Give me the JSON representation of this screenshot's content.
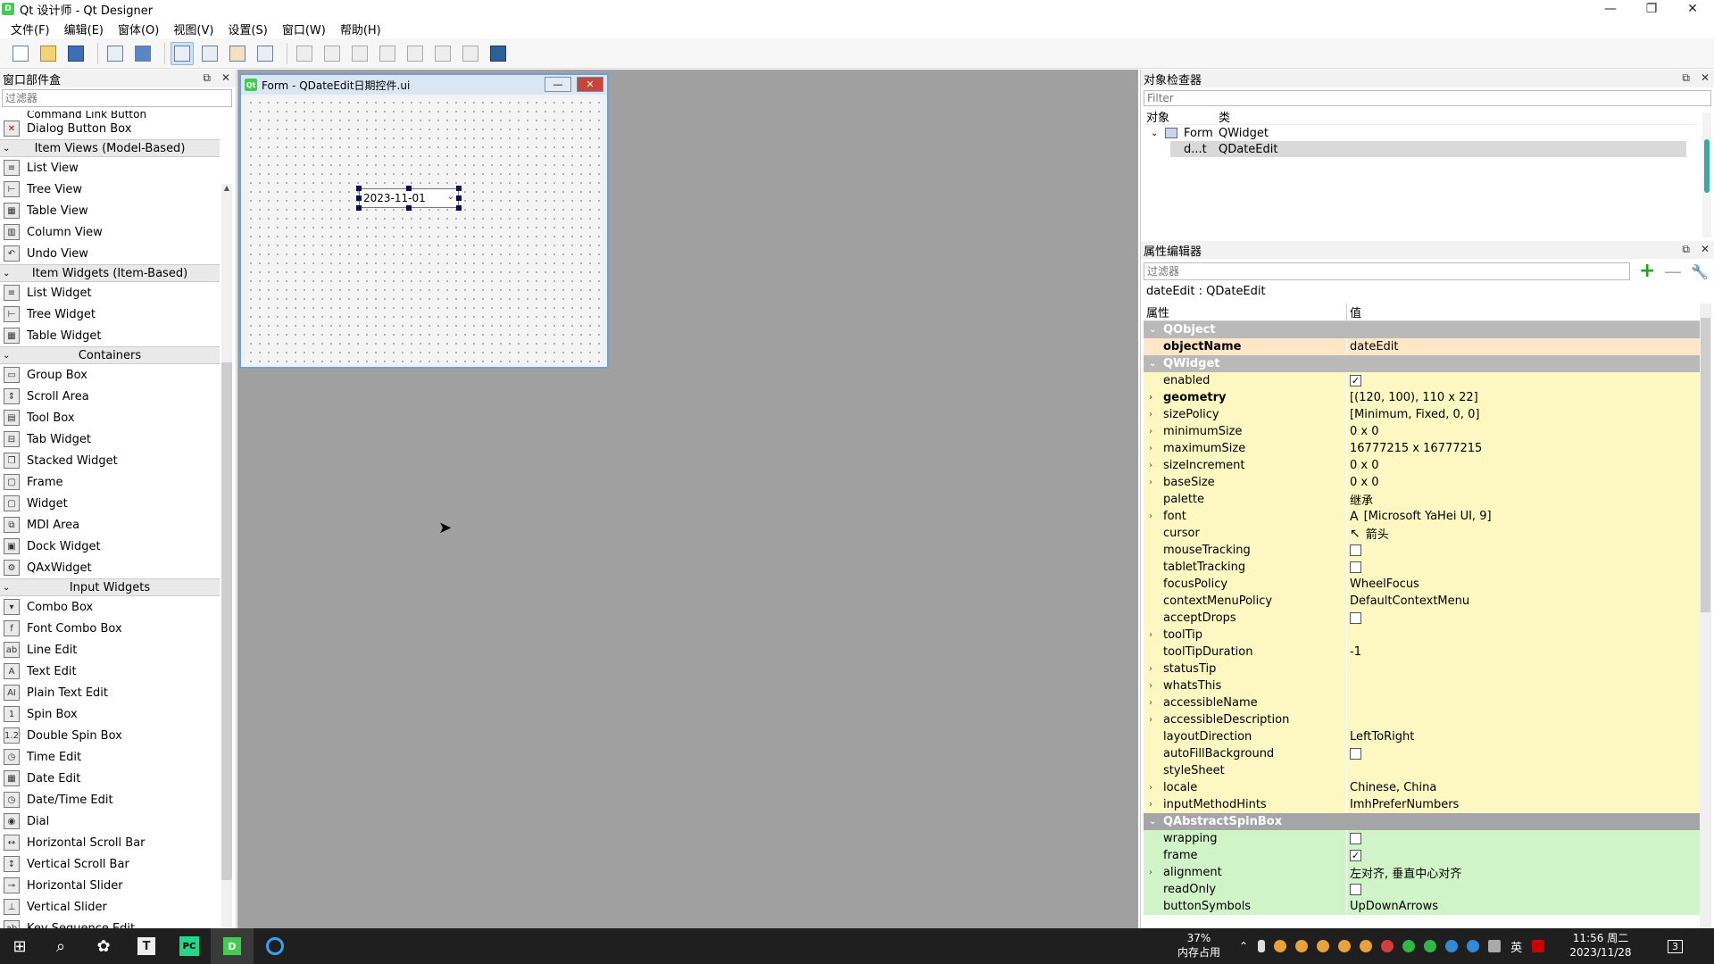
{
  "window": {
    "title": "Qt 设计师 - Qt Designer",
    "controls": {
      "minimize": "—",
      "maximize": "❐",
      "close": "✕"
    }
  },
  "menubar": {
    "items": [
      "文件(F)",
      "编辑(E)",
      "窗体(O)",
      "视图(V)",
      "设置(S)",
      "窗口(W)",
      "帮助(H)"
    ]
  },
  "widget_box": {
    "title": "窗口部件盒",
    "filter_placeholder": "过滤器",
    "partial_item": "Command Link Button",
    "items_top": [
      {
        "label": "Dialog Button Box",
        "icon": "dialog-button-box-icon"
      }
    ],
    "categories": [
      {
        "name": "Item Views (Model-Based)",
        "items": [
          "List View",
          "Tree View",
          "Table View",
          "Column View",
          "Undo View"
        ]
      },
      {
        "name": "Item Widgets (Item-Based)",
        "items": [
          "List Widget",
          "Tree Widget",
          "Table Widget"
        ]
      },
      {
        "name": "Containers",
        "items": [
          "Group Box",
          "Scroll Area",
          "Tool Box",
          "Tab Widget",
          "Stacked Widget",
          "Frame",
          "Widget",
          "MDI Area",
          "Dock Widget",
          "QAxWidget"
        ]
      },
      {
        "name": "Input Widgets",
        "items": [
          "Combo Box",
          "Font Combo Box",
          "Line Edit",
          "Text Edit",
          "Plain Text Edit",
          "Spin Box",
          "Double Spin Box",
          "Time Edit",
          "Date Edit",
          "Date/Time Edit",
          "Dial",
          "Horizontal Scroll Bar",
          "Vertical Scroll Bar",
          "Horizontal Slider",
          "Vertical Slider",
          "Key Sequence Edit"
        ]
      }
    ]
  },
  "form": {
    "title": "Form - QDateEdit日期控件.ui",
    "date_value": "2023-11-01"
  },
  "object_inspector": {
    "title": "对象检查器",
    "filter_placeholder": "Filter",
    "col_object": "对象",
    "col_class": "类",
    "rows": [
      {
        "object": "Form",
        "class": "QWidget"
      },
      {
        "object": "d...t",
        "class": "QDateEdit"
      }
    ]
  },
  "property_editor": {
    "title": "属性编辑器",
    "filter_placeholder": "过滤器",
    "object_class": "dateEdit : QDateEdit",
    "col_property": "属性",
    "col_value": "值",
    "rows": [
      {
        "kind": "group",
        "name": "QObject"
      },
      {
        "kind": "obj",
        "name": "objectName",
        "value": "dateEdit",
        "bold": true
      },
      {
        "kind": "group",
        "name": "QWidget"
      },
      {
        "kind": "wid",
        "name": "enabled",
        "check": true
      },
      {
        "kind": "wid",
        "name": "geometry",
        "value": "[(120, 100), 110 x 22]",
        "bold": true,
        "expand": true
      },
      {
        "kind": "wid",
        "name": "sizePolicy",
        "value": "[Minimum, Fixed, 0, 0]",
        "expand": true
      },
      {
        "kind": "wid",
        "name": "minimumSize",
        "value": "0 x 0",
        "expand": true
      },
      {
        "kind": "wid",
        "name": "maximumSize",
        "value": "16777215 x 16777215",
        "expand": true
      },
      {
        "kind": "wid",
        "name": "sizeIncrement",
        "value": "0 x 0",
        "expand": true
      },
      {
        "kind": "wid",
        "name": "baseSize",
        "value": "0 x 0",
        "expand": true
      },
      {
        "kind": "wid",
        "name": "palette",
        "value": "继承"
      },
      {
        "kind": "wid",
        "name": "font",
        "value": "[Microsoft YaHei UI, 9]",
        "expand": true,
        "prefix": "A"
      },
      {
        "kind": "wid",
        "name": "cursor",
        "value": "箭头",
        "prefix": "↖"
      },
      {
        "kind": "wid",
        "name": "mouseTracking",
        "check": false
      },
      {
        "kind": "wid",
        "name": "tabletTracking",
        "check": false
      },
      {
        "kind": "wid",
        "name": "focusPolicy",
        "value": "WheelFocus"
      },
      {
        "kind": "wid",
        "name": "contextMenuPolicy",
        "value": "DefaultContextMenu"
      },
      {
        "kind": "wid",
        "name": "acceptDrops",
        "check": false
      },
      {
        "kind": "wid",
        "name": "toolTip",
        "value": "",
        "expand": true
      },
      {
        "kind": "wid",
        "name": "toolTipDuration",
        "value": "-1"
      },
      {
        "kind": "wid",
        "name": "statusTip",
        "value": "",
        "expand": true
      },
      {
        "kind": "wid",
        "name": "whatsThis",
        "value": "",
        "expand": true
      },
      {
        "kind": "wid",
        "name": "accessibleName",
        "value": "",
        "expand": true
      },
      {
        "kind": "wid",
        "name": "accessibleDescription",
        "value": "",
        "expand": true
      },
      {
        "kind": "wid",
        "name": "layoutDirection",
        "value": "LeftToRight"
      },
      {
        "kind": "wid",
        "name": "autoFillBackground",
        "check": false
      },
      {
        "kind": "wid",
        "name": "styleSheet",
        "value": ""
      },
      {
        "kind": "wid",
        "name": "locale",
        "value": "Chinese, China",
        "expand": true
      },
      {
        "kind": "wid",
        "name": "inputMethodHints",
        "value": "ImhPreferNumbers",
        "expand": true
      },
      {
        "kind": "spin-group",
        "name": "QAbstractSpinBox"
      },
      {
        "kind": "spin",
        "name": "wrapping",
        "check": false
      },
      {
        "kind": "spin",
        "name": "frame",
        "check": true
      },
      {
        "kind": "spin",
        "name": "alignment",
        "value": "左对齐, 垂直中心对齐",
        "expand": true
      },
      {
        "kind": "spin",
        "name": "readOnly",
        "check": false
      },
      {
        "kind": "spin",
        "name": "buttonSymbols",
        "value": "UpDownArrows"
      }
    ]
  },
  "taskbar": {
    "memory_percent": "37%",
    "memory_label": "内存占用",
    "ime": "英",
    "time": "11:56 周二",
    "date": "2023/11/28",
    "notification_count": "3"
  },
  "colors": {
    "qobject_row": "#fde7c6",
    "qwidget_row": "#fdf7c2",
    "spinbox_row": "#d0f3c7",
    "group_header": "#b9b9b9"
  }
}
